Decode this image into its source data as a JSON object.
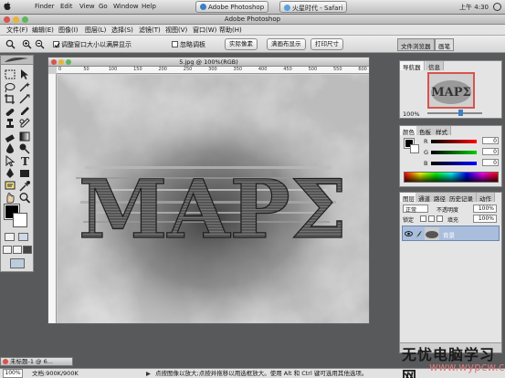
{
  "mac_menubar": {
    "items": [
      "Finder",
      "Edit",
      "View",
      "Go",
      "Window",
      "Help"
    ],
    "app_button": "Adobe Photoshop",
    "safari_button": "火星时代 - Safari",
    "clock": "上午 4:30"
  },
  "ps_titlebar": {
    "title": "Adobe Photoshop"
  },
  "ps_menu": {
    "items": [
      "文件(F)",
      "编辑(E)",
      "图像(I)",
      "图层(L)",
      "选择(S)",
      "滤镜(T)",
      "视图(V)",
      "窗口(W)",
      "帮助(H)"
    ]
  },
  "options_bar": {
    "resize_window_label": "调整窗口大小以满屏显示",
    "ignore_palettes_label": "忽略调板",
    "actual_pixels_label": "实际像素",
    "fit_screen_label": "满画布显示",
    "print_size_label": "打印尺寸",
    "file_browser_tab": "文件浏览器",
    "brushes_tab": "画笔"
  },
  "document": {
    "title": "5.jpg @ 100%(RGB)",
    "ruler_ticks": [
      "0",
      "50",
      "100",
      "150",
      "200",
      "250",
      "300",
      "350",
      "400",
      "450",
      "500",
      "550",
      "600"
    ],
    "artwork_text": "MAPΣ"
  },
  "navigator": {
    "tabs": [
      "导航器",
      "信息"
    ],
    "zoom": "100%",
    "thumb_text": "MAPΣ"
  },
  "color_panel": {
    "tabs": [
      "颜色",
      "色板",
      "样式"
    ],
    "channels": [
      "R",
      "G",
      "B"
    ],
    "values": [
      "0",
      "0",
      "0"
    ]
  },
  "layers_panel": {
    "tabs": [
      "图层",
      "通道",
      "路径",
      "历史记录",
      "动作"
    ],
    "blend_mode": "正常",
    "opacity_label": "不透明度",
    "opacity_value": "100%",
    "lock_label": "锁定",
    "fill_label": "填充",
    "fill_value": "100%",
    "layer_name": "背景"
  },
  "minimized_doc": "未标题-1 @ 6...",
  "status_bar": {
    "zoom": "100%",
    "doc_info": "文档:900K/900K",
    "hint": "点按图像以放大;点按并拖移以用选框放大。使用 Alt 和 Ctrl 键可选用其他选项。"
  },
  "watermark": {
    "line1": "无忧电脑学习网",
    "line2": "www.wypcw.com"
  },
  "colors": {
    "workspace": "#58595b",
    "panel": "#e4e4e4",
    "accent_blue": "#3b7fc4",
    "layer_selected": "#a8bedc"
  },
  "toolbox_tools": [
    "marquee-tool",
    "move-tool",
    "lasso-tool",
    "magic-wand-tool",
    "crop-tool",
    "slice-tool",
    "healing-brush-tool",
    "brush-tool",
    "clone-stamp-tool",
    "history-brush-tool",
    "eraser-tool",
    "gradient-tool",
    "blur-tool",
    "dodge-tool",
    "path-selection-tool",
    "type-tool",
    "pen-tool",
    "shape-tool",
    "notes-tool",
    "eyedropper-tool",
    "hand-tool",
    "zoom-tool"
  ]
}
